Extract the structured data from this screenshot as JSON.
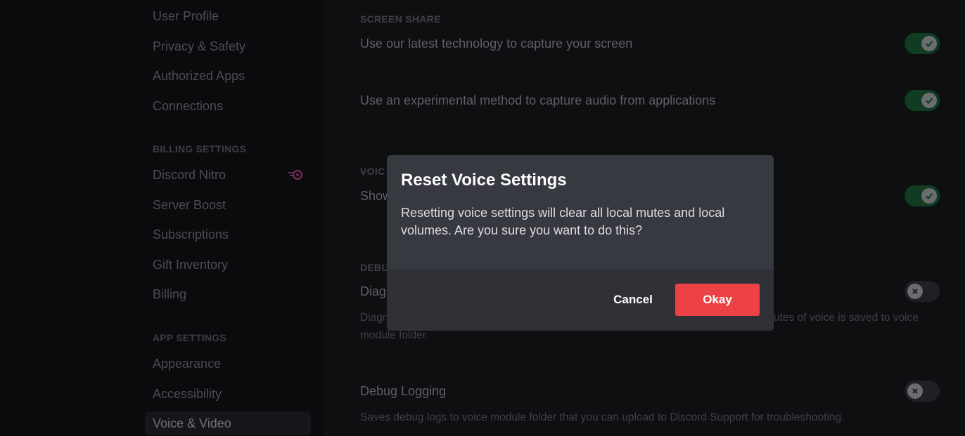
{
  "sidebar": {
    "items_top": [
      {
        "label": "User Profile"
      },
      {
        "label": "Privacy & Safety"
      },
      {
        "label": "Authorized Apps"
      },
      {
        "label": "Connections"
      }
    ],
    "billing_header": "BILLING SETTINGS",
    "billing_items": [
      {
        "label": "Discord Nitro"
      },
      {
        "label": "Server Boost"
      },
      {
        "label": "Subscriptions"
      },
      {
        "label": "Gift Inventory"
      },
      {
        "label": "Billing"
      }
    ],
    "app_header": "APP SETTINGS",
    "app_items": [
      {
        "label": "Appearance"
      },
      {
        "label": "Accessibility"
      },
      {
        "label": "Voice & Video"
      }
    ]
  },
  "content": {
    "screen_share_header": "SCREEN SHARE",
    "capture_screen_title": "Use our latest technology to capture your screen",
    "capture_audio_title": "Use an experimental method to capture audio from applications",
    "voice_header_partial": "VOIC",
    "show_title_partial": "Show",
    "debug_header_partial": "DEBUG",
    "diag_title_partial": "Diag",
    "diag_desc_left": "Diagn",
    "diag_desc_right": "utes of voice is saved to voice",
    "diag_desc_line2": "module folder.",
    "debug_logging_title": "Debug Logging",
    "debug_logging_desc": "Saves debug logs to voice module folder that you can upload to Discord Support for troubleshooting.",
    "toggle_states": {
      "capture_screen": true,
      "capture_audio": true,
      "show": true,
      "diagnostic": false,
      "debug_logging": false
    }
  },
  "modal": {
    "title": "Reset Voice Settings",
    "body": "Resetting voice settings will clear all local mutes and local volumes. Are you sure you want to do this?",
    "cancel_label": "Cancel",
    "okay_label": "Okay"
  },
  "colors": {
    "danger": "#ed4245",
    "modal_bg": "#36393f",
    "modal_footer_bg": "#2f3136",
    "toggle_on": "#123c22"
  }
}
